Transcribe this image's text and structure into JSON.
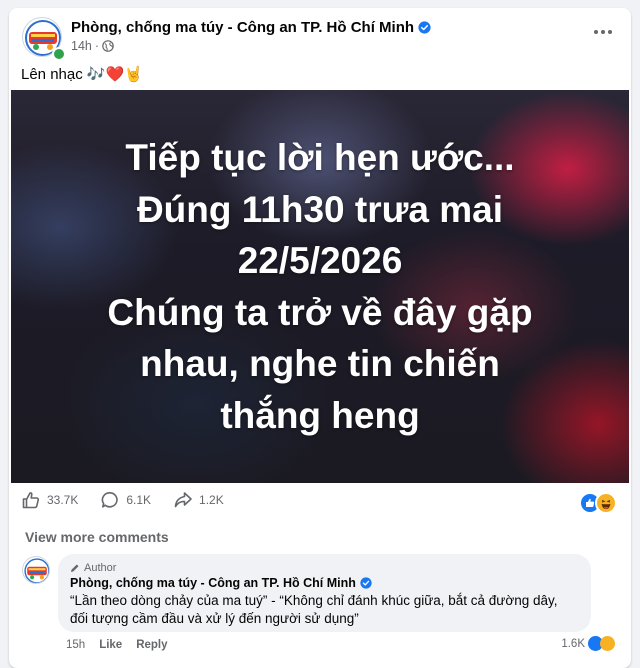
{
  "post": {
    "page_name": "Phòng, chống ma túy - Công an TP. Hồ Chí Minh",
    "time": "14h",
    "privacy_icon": "globe-icon",
    "text": "Lên nhạc 🎶❤️🤘",
    "image_lines": [
      "Tiếp tục lời hẹn ước...",
      "Đúng 11h30 trưa mai",
      "22/5/2026",
      "Chúng ta trở về đây gặp",
      "nhau, nghe tin chiến",
      "thắng heng"
    ]
  },
  "stats": {
    "likes": "33.7K",
    "comments": "6.1K",
    "shares": "1.2K"
  },
  "comments_section": {
    "view_more": "View more comments"
  },
  "comment": {
    "author_tag": "Author",
    "name": "Phòng, chống ma túy - Công an TP. Hồ Chí Minh",
    "text": "“Lần theo dòng chảy của ma tuý” - “Không chỉ đánh khúc giữa, bắt cả đường dây, đối tượng cầm đầu và xử lý đến người sử dụng”",
    "time": "15h",
    "like_label": "Like",
    "reply_label": "Reply",
    "reaction_count": "1.6K"
  },
  "colors": {
    "verified": "#1877f2",
    "online": "#31a24c",
    "secondary_text": "#65676b",
    "like_blue": "#1877f2",
    "haha_yellow": "#f7b125"
  }
}
